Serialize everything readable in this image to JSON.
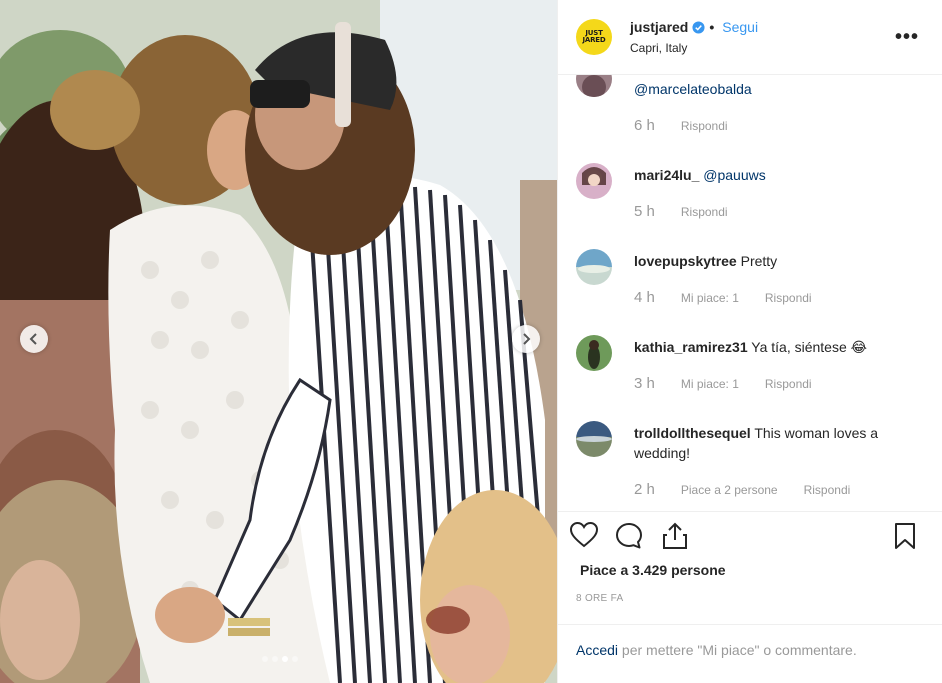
{
  "post": {
    "username": "justjared",
    "separator": "•",
    "follow_label": "Segui",
    "location": "Capri, Italy",
    "logo_text_line1": "JUST",
    "logo_text_line2": "JARED",
    "more_label": "•••"
  },
  "comments": [
    {
      "user": "",
      "text": "@marcelateobalda",
      "time": "6 h",
      "likes": "",
      "reply": "Rispondi"
    },
    {
      "user": "mari24lu_",
      "text": "@pauuws",
      "time": "5 h",
      "likes": "",
      "reply": "Rispondi"
    },
    {
      "user": "lovepupskytree",
      "text": "Pretty",
      "time": "4 h",
      "likes": "Mi piace: 1",
      "reply": "Rispondi"
    },
    {
      "user": "kathia_ramirez31",
      "text": "Ya tía, siéntese 😂",
      "time": "3 h",
      "likes": "Mi piace: 1",
      "reply": "Rispondi"
    },
    {
      "user": "trolldollthesequel",
      "text": "This woman loves a wedding!",
      "time": "2 h",
      "likes": "Piace a 2 persone",
      "reply": "Rispondi"
    }
  ],
  "actions": {
    "like_icon": "heart-icon",
    "comment_icon": "comment-icon",
    "share_icon": "share-icon",
    "save_icon": "bookmark-icon"
  },
  "likes_text": "Piace a 3.429 persone",
  "time_ago": "8 ORE FA",
  "login": {
    "link": "Accedi",
    "rest": "per mettere \"Mi piace\" o commentare."
  },
  "carousel": {
    "slides": 4,
    "active_slide": 3
  },
  "colors": {
    "accent": "#3897f0",
    "link": "#003569",
    "muted": "#999999",
    "logo_bg": "#f4d81a"
  }
}
